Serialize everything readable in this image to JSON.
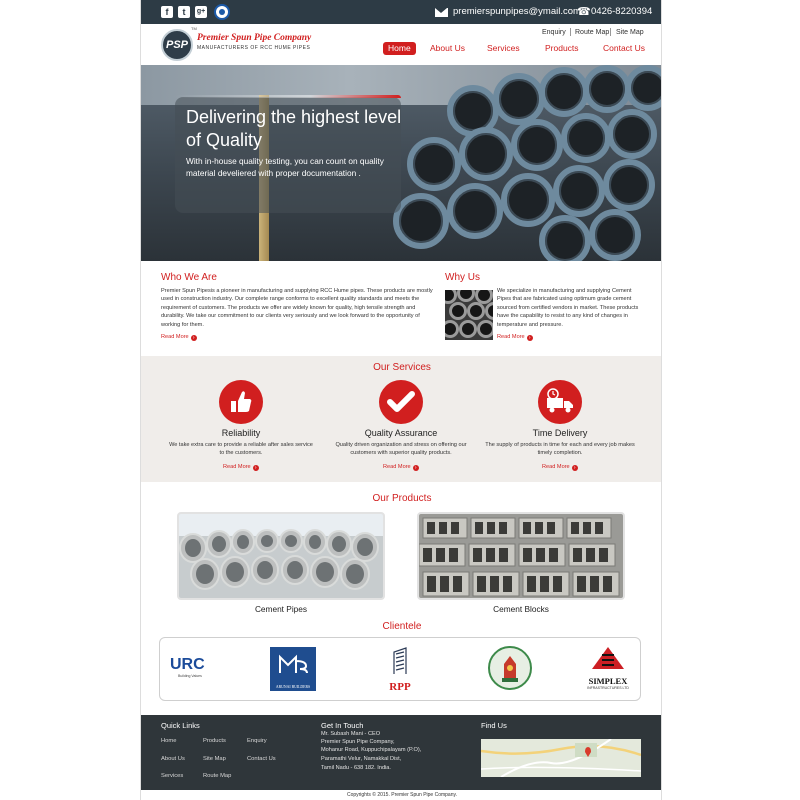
{
  "topbar": {
    "social": [
      {
        "icon": "facebook-icon",
        "glyph": "f"
      },
      {
        "icon": "twitter-icon",
        "glyph": "t"
      },
      {
        "icon": "google-plus-icon",
        "glyph": "g+"
      }
    ],
    "email": "premierspunpipes@ymail.com",
    "phone": "0426-8220394"
  },
  "header": {
    "logo_mark": "PSP",
    "logo_tm": "TM",
    "logo_name": "Premier Spun Pipe Company",
    "logo_tagline": "Manufacturers of Rcc Hume Pipes",
    "util_links": [
      "Enquiry",
      "Route Map",
      "Site Map"
    ],
    "nav": [
      "Home",
      "About Us",
      "Services",
      "Products",
      "Contact Us"
    ],
    "nav_active": "Home"
  },
  "hero": {
    "title": "Delivering the highest level of Quality",
    "text": "With in-house quality testing, you can count on quality material develiered with proper documentation ."
  },
  "who": {
    "title": "Who We Are",
    "text": "Premier Spun Pipesis a pioneer in manufacturing and supplying RCC Hume pipes. These products are mostly used in construction industry. Our complete range conforms to excellent quality standards and meets the requirement of customers. The products we offer are widely known for quality, high tensile strength and durability. We take our commitment to our clients very seriously and we look forward to the opportunity of working for them.",
    "read_more": "Read More"
  },
  "why": {
    "title": "Why Us",
    "text": "We specialize in manufacturing and supplying Cement Pipes that are fabricated using optimum grade cement sourced from certified vendors in market. These products have the capability to resist to any kind of changes in temperature and pressure.",
    "read_more": "Read More"
  },
  "services": {
    "title": "Our Services",
    "items": [
      {
        "title": "Reliability",
        "text": "We take extra care to provide a reliable after sales service to the customers.",
        "read_more": "Read More",
        "icon": "thumbs-up-icon"
      },
      {
        "title": "Quality Assurance",
        "text": "Quality driven organization and stress on offering our customers with superior quality products.",
        "read_more": "Read More",
        "icon": "checkmark-icon"
      },
      {
        "title": "Time Delivery",
        "text": "The supply of products in time for each and every job makes timely completion.",
        "read_more": "Read More",
        "icon": "delivery-truck-icon"
      }
    ]
  },
  "products": {
    "title": "Our Products",
    "items": [
      "Cement Pipes",
      "Cement Blocks"
    ]
  },
  "clientele": {
    "title": "Clientele",
    "logos": [
      {
        "text": "URC",
        "sub": "Building Values"
      },
      {
        "text": "ARUNAI BUILDERS"
      },
      {
        "text": "RPP"
      },
      {
        "text": ""
      },
      {
        "text": "SIMPLEX",
        "sub": "INFRASTRUCTURES LTD"
      }
    ]
  },
  "footer": {
    "quick_links_title": "Quick Links",
    "quick_links": [
      "Home",
      "Products",
      "Enquiry",
      "About Us",
      "Site Map",
      "Contact Us",
      "Services",
      "Route Map"
    ],
    "get_in_touch_title": "Get In Touch",
    "address": [
      "Mr. Subash Mani - CEO",
      "Premier Spun Pipe Company,",
      "Mohanur Road, Kuppuchipalayam (P.O),",
      "Paramathi Velur, Namakkal Dist,",
      "Tamil Nadu - 638 182. India."
    ],
    "find_us_title": "Find Us",
    "copyright": "Copyrights © 2015. Premier Spun Pipe Company."
  },
  "colors": {
    "brand_red": "#d11f1f",
    "topbar": "#2d3b45",
    "footer": "#2f363a",
    "services_bg": "#f0edea"
  }
}
